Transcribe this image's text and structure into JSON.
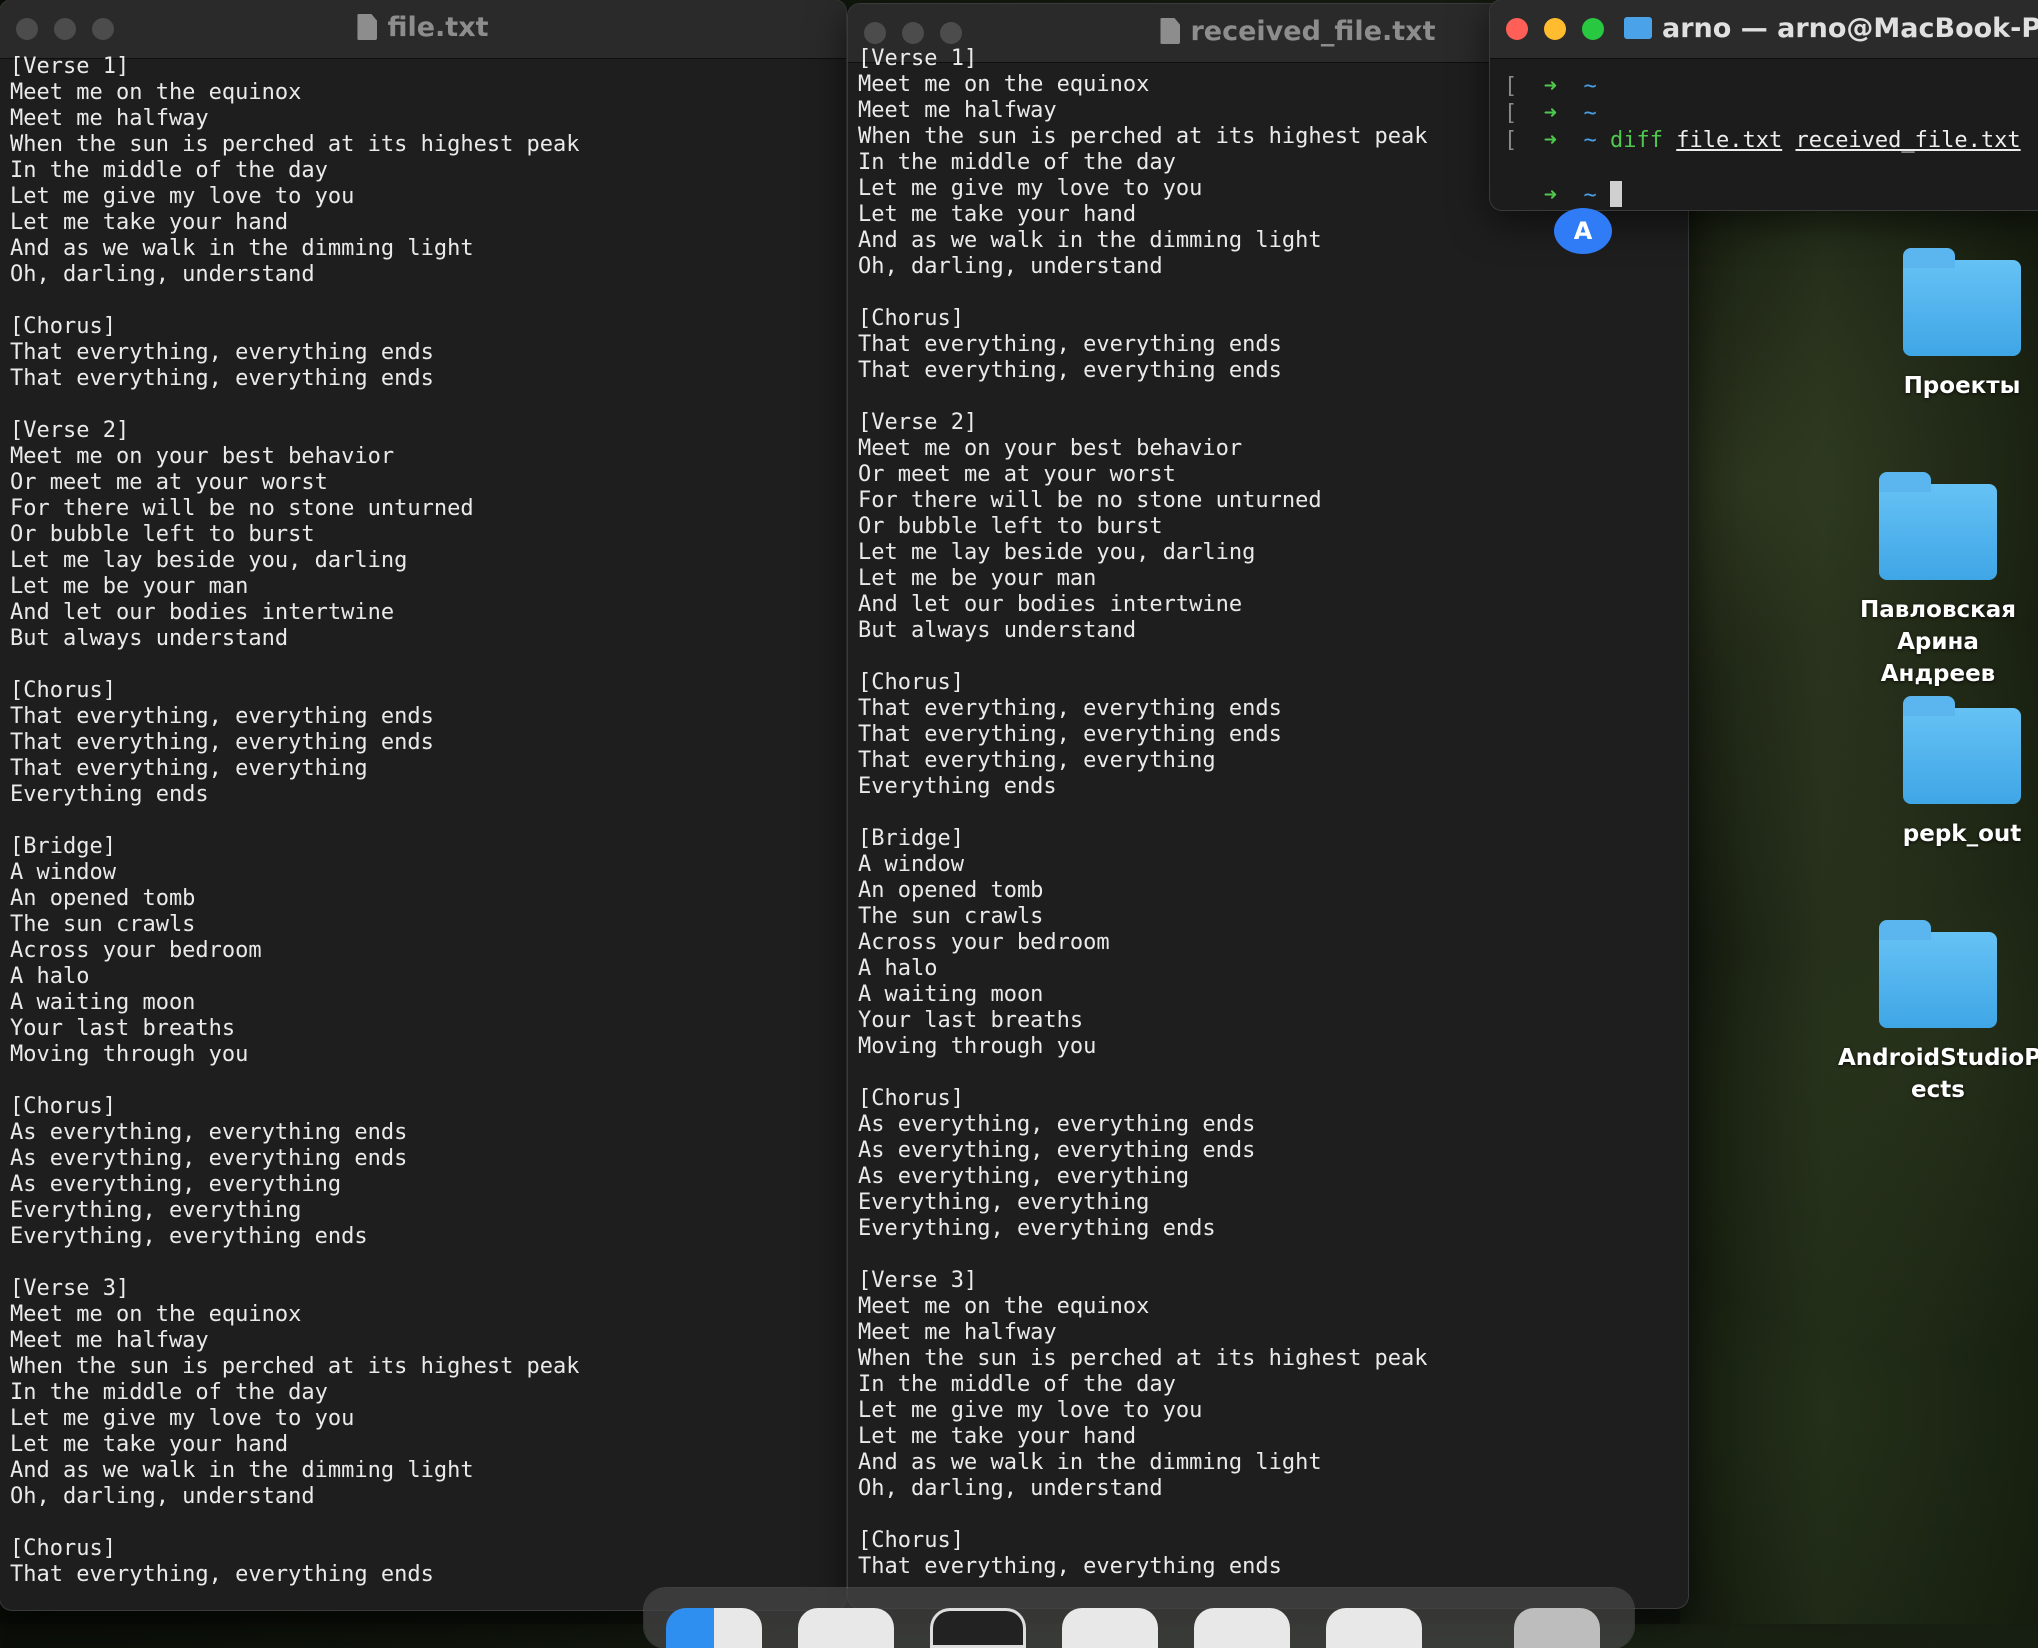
{
  "window1": {
    "title": "file.txt",
    "text": "[Verse 1]\nMeet me on the equinox\nMeet me halfway\nWhen the sun is perched at its highest peak\nIn the middle of the day\nLet me give my love to you\nLet me take your hand\nAnd as we walk in the dimming light\nOh, darling, understand\n\n[Chorus]\nThat everything, everything ends\nThat everything, everything ends\n\n[Verse 2]\nMeet me on your best behavior\nOr meet me at your worst\nFor there will be no stone unturned\nOr bubble left to burst\nLet me lay beside you, darling\nLet me be your man\nAnd let our bodies intertwine\nBut always understand\n\n[Chorus]\nThat everything, everything ends\nThat everything, everything ends\nThat everything, everything\nEverything ends\n\n[Bridge]\nA window\nAn opened tomb\nThe sun crawls\nAcross your bedroom\nA halo\nA waiting moon\nYour last breaths\nMoving through you\n\n[Chorus]\nAs everything, everything ends\nAs everything, everything ends\nAs everything, everything\nEverything, everything\nEverything, everything ends\n\n[Verse 3]\nMeet me on the equinox\nMeet me halfway\nWhen the sun is perched at its highest peak\nIn the middle of the day\nLet me give my love to you\nLet me take your hand\nAnd as we walk in the dimming light\nOh, darling, understand\n\n[Chorus]\nThat everything, everything ends"
  },
  "window2": {
    "title": "received_file.txt",
    "text": "[Verse 1]\nMeet me on the equinox\nMeet me halfway\nWhen the sun is perched at its highest peak\nIn the middle of the day\nLet me give my love to you\nLet me take your hand\nAnd as we walk in the dimming light\nOh, darling, understand\n\n[Chorus]\nThat everything, everything ends\nThat everything, everything ends\n\n[Verse 2]\nMeet me on your best behavior\nOr meet me at your worst\nFor there will be no stone unturned\nOr bubble left to burst\nLet me lay beside you, darling\nLet me be your man\nAnd let our bodies intertwine\nBut always understand\n\n[Chorus]\nThat everything, everything ends\nThat everything, everything ends\nThat everything, everything\nEverything ends\n\n[Bridge]\nA window\nAn opened tomb\nThe sun crawls\nAcross your bedroom\nA halo\nA waiting moon\nYour last breaths\nMoving through you\n\n[Chorus]\nAs everything, everything ends\nAs everything, everything ends\nAs everything, everything\nEverything, everything\nEverything, everything ends\n\n[Verse 3]\nMeet me on the equinox\nMeet me halfway\nWhen the sun is perched at its highest peak\nIn the middle of the day\nLet me give my love to you\nLet me take your hand\nAnd as we walk in the dimming light\nOh, darling, understand\n\n[Chorus]\nThat everything, everything ends"
  },
  "terminal": {
    "title": "arno — arno@MacBook-Pro-E",
    "bracket": "[",
    "arrow": "➜",
    "tilde": "~",
    "command": "diff",
    "arg1": "file.txt",
    "arg2": "received_file.txt"
  },
  "avatar": {
    "letter": "A"
  },
  "desktop_icons": [
    {
      "label": "Проекты"
    },
    {
      "label": "Павловская Арина Андреев"
    },
    {
      "label": "pepk_out"
    },
    {
      "label": "AndroidStudioP ects"
    }
  ],
  "colors": {
    "close": "#ff5f57",
    "minimize": "#febc2e",
    "zoom": "#28c840",
    "prompt_arrow": "#4ec94e",
    "prompt_tilde": "#4aa0e8",
    "folder": "#4aa3e8"
  }
}
